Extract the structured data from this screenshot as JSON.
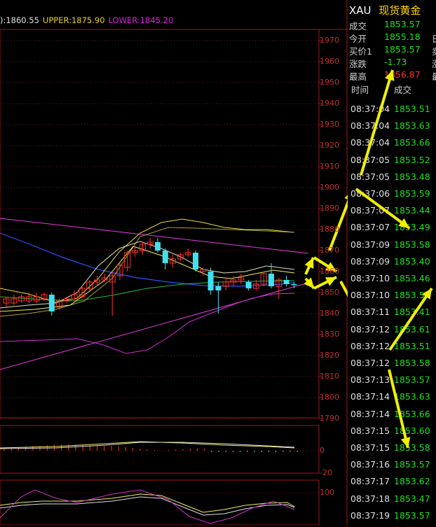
{
  "legend": {
    "mid_text": "):1860.55",
    "upper_text": "UPPER:1875.90",
    "lower_text": "LOWER:1845.20"
  },
  "price_axis": [
    "1970",
    "1960",
    "1950",
    "1940",
    "1930",
    "1920",
    "1910",
    "1900",
    "1890",
    "1880",
    "1870",
    "1860",
    "1850",
    "1840",
    "1830",
    "1820",
    "1810",
    "1800",
    "1790"
  ],
  "macd_axis": [
    "0",
    "-20"
  ],
  "kdj_axis": [
    "100"
  ],
  "quote": {
    "symbol": "XAU",
    "name": "现货黄金",
    "rows": [
      {
        "label": "成交",
        "value": "1853.57",
        "color": "#20e020",
        "extra": ""
      },
      {
        "label": "今开",
        "value": "1855.18",
        "color": "#20e020",
        "extra": "日"
      },
      {
        "label": "买价1",
        "value": "1853.57",
        "color": "#20e020",
        "extra": "卖"
      },
      {
        "label": "涨跌",
        "value": "-1.73",
        "color": "#20e020",
        "extra": "涨"
      },
      {
        "label": "最高",
        "value": "1856.87",
        "color": "#ff3030",
        "extra": "最"
      }
    ]
  },
  "trades": {
    "header_time": "时间",
    "header_price": "成交",
    "rows": [
      {
        "time": "08:37:04",
        "price": "1853.51"
      },
      {
        "time": "08:37:04",
        "price": "1853.63"
      },
      {
        "time": "08:37:04",
        "price": "1853.66"
      },
      {
        "time": "08:37:05",
        "price": "1853.52"
      },
      {
        "time": "08:37:05",
        "price": "1853.48"
      },
      {
        "time": "08:37:06",
        "price": "1853.59"
      },
      {
        "time": "08:37:07",
        "price": "1853.44"
      },
      {
        "time": "08:37:07",
        "price": "1853.49"
      },
      {
        "time": "08:37:09",
        "price": "1853.58"
      },
      {
        "time": "08:37:09",
        "price": "1853.40"
      },
      {
        "time": "08:37:10",
        "price": "1853.46"
      },
      {
        "time": "08:37:10",
        "price": "1853.5"
      },
      {
        "time": "08:37:11",
        "price": "1853.41"
      },
      {
        "time": "08:37:12",
        "price": "1853.61"
      },
      {
        "time": "08:37:12",
        "price": "1853.51"
      },
      {
        "time": "08:37:12",
        "price": "1853.58"
      },
      {
        "time": "08:37:13",
        "price": "1853.57"
      },
      {
        "time": "08:37:14",
        "price": "1853.63"
      },
      {
        "time": "08:37:14",
        "price": "1853.66"
      },
      {
        "time": "08:37:15",
        "price": "1853.60"
      },
      {
        "time": "08:37:15",
        "price": "1853.58"
      },
      {
        "time": "08:37:16",
        "price": "1853.57"
      },
      {
        "time": "08:37:17",
        "price": "1853.62"
      },
      {
        "time": "08:37:18",
        "price": "1853.47"
      },
      {
        "time": "08:37:19",
        "price": "1853.57"
      }
    ]
  },
  "candles": [
    {
      "o": 1847,
      "c": 1845,
      "h": 1848,
      "l": 1843,
      "up": true
    },
    {
      "o": 1845,
      "c": 1847,
      "h": 1849,
      "l": 1844,
      "up": true
    },
    {
      "o": 1846,
      "c": 1848,
      "h": 1849,
      "l": 1845,
      "up": true
    },
    {
      "o": 1848,
      "c": 1846,
      "h": 1850,
      "l": 1845,
      "up": true
    },
    {
      "o": 1846,
      "c": 1848,
      "h": 1850,
      "l": 1845,
      "up": true
    },
    {
      "o": 1847,
      "c": 1849,
      "h": 1850,
      "l": 1846,
      "up": true
    },
    {
      "o": 1849,
      "c": 1841,
      "h": 1850,
      "l": 1839,
      "up": false
    },
    {
      "o": 1843,
      "c": 1846,
      "h": 1847,
      "l": 1842,
      "up": true
    },
    {
      "o": 1846,
      "c": 1847,
      "h": 1848,
      "l": 1845,
      "up": true
    },
    {
      "o": 1847,
      "c": 1849,
      "h": 1851,
      "l": 1846,
      "up": true
    },
    {
      "o": 1848,
      "c": 1852,
      "h": 1853,
      "l": 1847,
      "up": true
    },
    {
      "o": 1852,
      "c": 1855,
      "h": 1856,
      "l": 1851,
      "up": true
    },
    {
      "o": 1855,
      "c": 1856,
      "h": 1858,
      "l": 1853,
      "up": true
    },
    {
      "o": 1856,
      "c": 1857,
      "h": 1859,
      "l": 1855,
      "up": true
    },
    {
      "o": 1855,
      "c": 1858,
      "h": 1860,
      "l": 1839,
      "up": true
    },
    {
      "o": 1858,
      "c": 1863,
      "h": 1864,
      "l": 1856,
      "up": true
    },
    {
      "o": 1862,
      "c": 1869,
      "h": 1870,
      "l": 1860,
      "up": true
    },
    {
      "o": 1869,
      "c": 1870,
      "h": 1872,
      "l": 1867,
      "up": true
    },
    {
      "o": 1870,
      "c": 1873,
      "h": 1874,
      "l": 1868,
      "up": true
    },
    {
      "o": 1873,
      "c": 1874,
      "h": 1876,
      "l": 1871,
      "up": true
    },
    {
      "o": 1874,
      "c": 1870,
      "h": 1876,
      "l": 1869,
      "up": false
    },
    {
      "o": 1870,
      "c": 1864,
      "h": 1871,
      "l": 1861,
      "up": false
    },
    {
      "o": 1864,
      "c": 1866,
      "h": 1868,
      "l": 1862,
      "up": true
    },
    {
      "o": 1866,
      "c": 1868,
      "h": 1869,
      "l": 1865,
      "up": true
    },
    {
      "o": 1868,
      "c": 1869,
      "h": 1871,
      "l": 1867,
      "up": true
    },
    {
      "o": 1869,
      "c": 1861,
      "h": 1870,
      "l": 1860,
      "up": false
    },
    {
      "o": 1861,
      "c": 1860,
      "h": 1862,
      "l": 1858,
      "up": true
    },
    {
      "o": 1860,
      "c": 1851,
      "h": 1862,
      "l": 1849,
      "up": false
    },
    {
      "o": 1851,
      "c": 1853,
      "h": 1855,
      "l": 1840,
      "up": false
    },
    {
      "o": 1853,
      "c": 1855,
      "h": 1857,
      "l": 1851,
      "up": true
    },
    {
      "o": 1855,
      "c": 1856,
      "h": 1858,
      "l": 1853,
      "up": true
    },
    {
      "o": 1856,
      "c": 1857,
      "h": 1859,
      "l": 1854,
      "up": true
    },
    {
      "o": 1855,
      "c": 1852,
      "h": 1856,
      "l": 1851,
      "up": false
    },
    {
      "o": 1852,
      "c": 1854,
      "h": 1856,
      "l": 1851,
      "up": true
    },
    {
      "o": 1854,
      "c": 1859,
      "h": 1860,
      "l": 1853,
      "up": true
    },
    {
      "o": 1859,
      "c": 1853,
      "h": 1864,
      "l": 1852,
      "up": false
    },
    {
      "o": 1853,
      "c": 1856,
      "h": 1857,
      "l": 1847,
      "up": true
    },
    {
      "o": 1856,
      "c": 1854,
      "h": 1858,
      "l": 1853,
      "up": false
    },
    {
      "o": 1854,
      "c": 1853.5,
      "h": 1855,
      "l": 1852,
      "up": false
    }
  ]
}
